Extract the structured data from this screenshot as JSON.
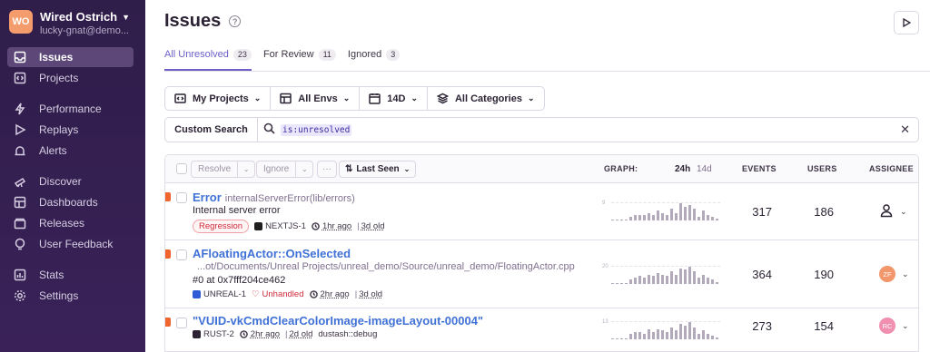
{
  "sidebar": {
    "org_initials": "WO",
    "org_name": "Wired Ostrich",
    "org_email": "lucky-gnat@demo...",
    "items": [
      {
        "label": "Issues"
      },
      {
        "label": "Projects"
      },
      {
        "label": "Performance"
      },
      {
        "label": "Replays"
      },
      {
        "label": "Alerts"
      },
      {
        "label": "Discover"
      },
      {
        "label": "Dashboards"
      },
      {
        "label": "Releases"
      },
      {
        "label": "User Feedback"
      },
      {
        "label": "Stats"
      },
      {
        "label": "Settings"
      }
    ],
    "active_item": "Issues",
    "colors": {
      "background": "#2f1d4a",
      "active": "#5c4778",
      "avatar": "#f59c6c"
    }
  },
  "header": {
    "title": "Issues",
    "help_icon": "question-circle-icon",
    "play_icon": "play-icon"
  },
  "tabs": [
    {
      "label": "All Unresolved",
      "count": "23"
    },
    {
      "label": "For Review",
      "count": "11"
    },
    {
      "label": "Ignored",
      "count": "3"
    }
  ],
  "filters": {
    "projects": "My Projects",
    "envs": "All Envs",
    "date": "14D",
    "categories": "All Categories"
  },
  "search": {
    "custom_label": "Custom Search",
    "query": "is:unresolved",
    "clear_icon": "close-icon"
  },
  "table": {
    "resolve_label": "Resolve",
    "ignore_label": "Ignore",
    "more_label": "···",
    "sort_label": "Last Seen",
    "graph_label": "GRAPH:",
    "graph_24h": "24h",
    "graph_14d": "14d",
    "events_label": "EVENTS",
    "users_label": "USERS",
    "assignee_label": "ASSIGNEE"
  },
  "issues": [
    {
      "title": "Error",
      "subtitle": "internalServerError(lib/errors)",
      "message": "Internal server error",
      "badge": "Regression",
      "project": "NEXTJS-1",
      "last_seen": "1hr ago",
      "age": "3d old",
      "events": "317",
      "users": "186",
      "spark_max": "9",
      "spark": [
        0,
        0,
        0,
        0,
        2,
        3,
        3,
        3,
        4,
        3,
        5,
        4,
        3,
        6,
        4,
        9,
        7,
        8,
        6,
        2,
        5,
        3,
        2,
        1
      ],
      "assignee": {
        "type": "unassigned-icon"
      }
    },
    {
      "title": "AFloatingActor::OnSelected",
      "path": "...ot/Documents/Unreal Projects/unreal_demo/Source/unreal_demo/FloatingActor.cpp",
      "message": "#0 at 0x7fff204ce462",
      "project": "UNREAL-1",
      "mechanism": "Unhandled",
      "last_seen": "2hr ago",
      "age": "3d old",
      "events": "364",
      "users": "190",
      "spark_max": "20",
      "spark": [
        0,
        0,
        0,
        0,
        3,
        4,
        5,
        4,
        6,
        5,
        7,
        6,
        5,
        8,
        6,
        10,
        9,
        11,
        8,
        4,
        6,
        4,
        3,
        1
      ],
      "assignee": {
        "initials": "ZF",
        "color": "#f2976b"
      }
    },
    {
      "title": "\"VUID-vkCmdClearColorImage-imageLayout-00004\"",
      "project": "RUST-2",
      "last_seen": "2hr ago",
      "age": "2d old",
      "logger": "dustash::debug",
      "events": "273",
      "users": "154",
      "spark_max": "13",
      "spark": [
        0,
        0,
        0,
        0,
        3,
        4,
        4,
        3,
        6,
        4,
        6,
        5,
        4,
        7,
        5,
        9,
        8,
        10,
        7,
        3,
        5,
        3,
        2,
        1
      ],
      "assignee": {
        "initials": "RC",
        "color": "#f08fb0"
      }
    }
  ]
}
